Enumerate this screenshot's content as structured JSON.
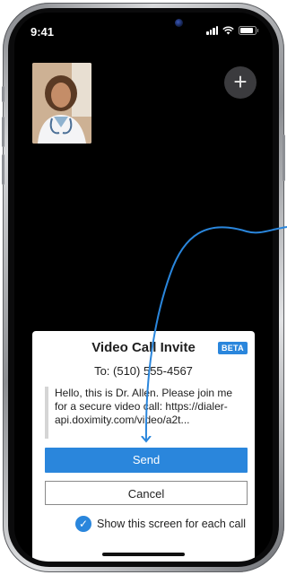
{
  "status_bar": {
    "time": "9:41"
  },
  "video": {
    "add_label": "+"
  },
  "invite": {
    "title": "Video Call Invite",
    "beta": "BETA",
    "recipient": "To: (510) 555-4567",
    "message": "Hello, this is Dr. Allen. Please join me for a secure video call: https://dialer-api.doximity.com/video/a2t...",
    "send_label": "Send",
    "cancel_label": "Cancel",
    "show_screen_label": "Show this screen for each call",
    "show_screen_checked": true
  },
  "colors": {
    "accent": "#2a86dc",
    "annotation_arrow": "#2a86dc"
  }
}
